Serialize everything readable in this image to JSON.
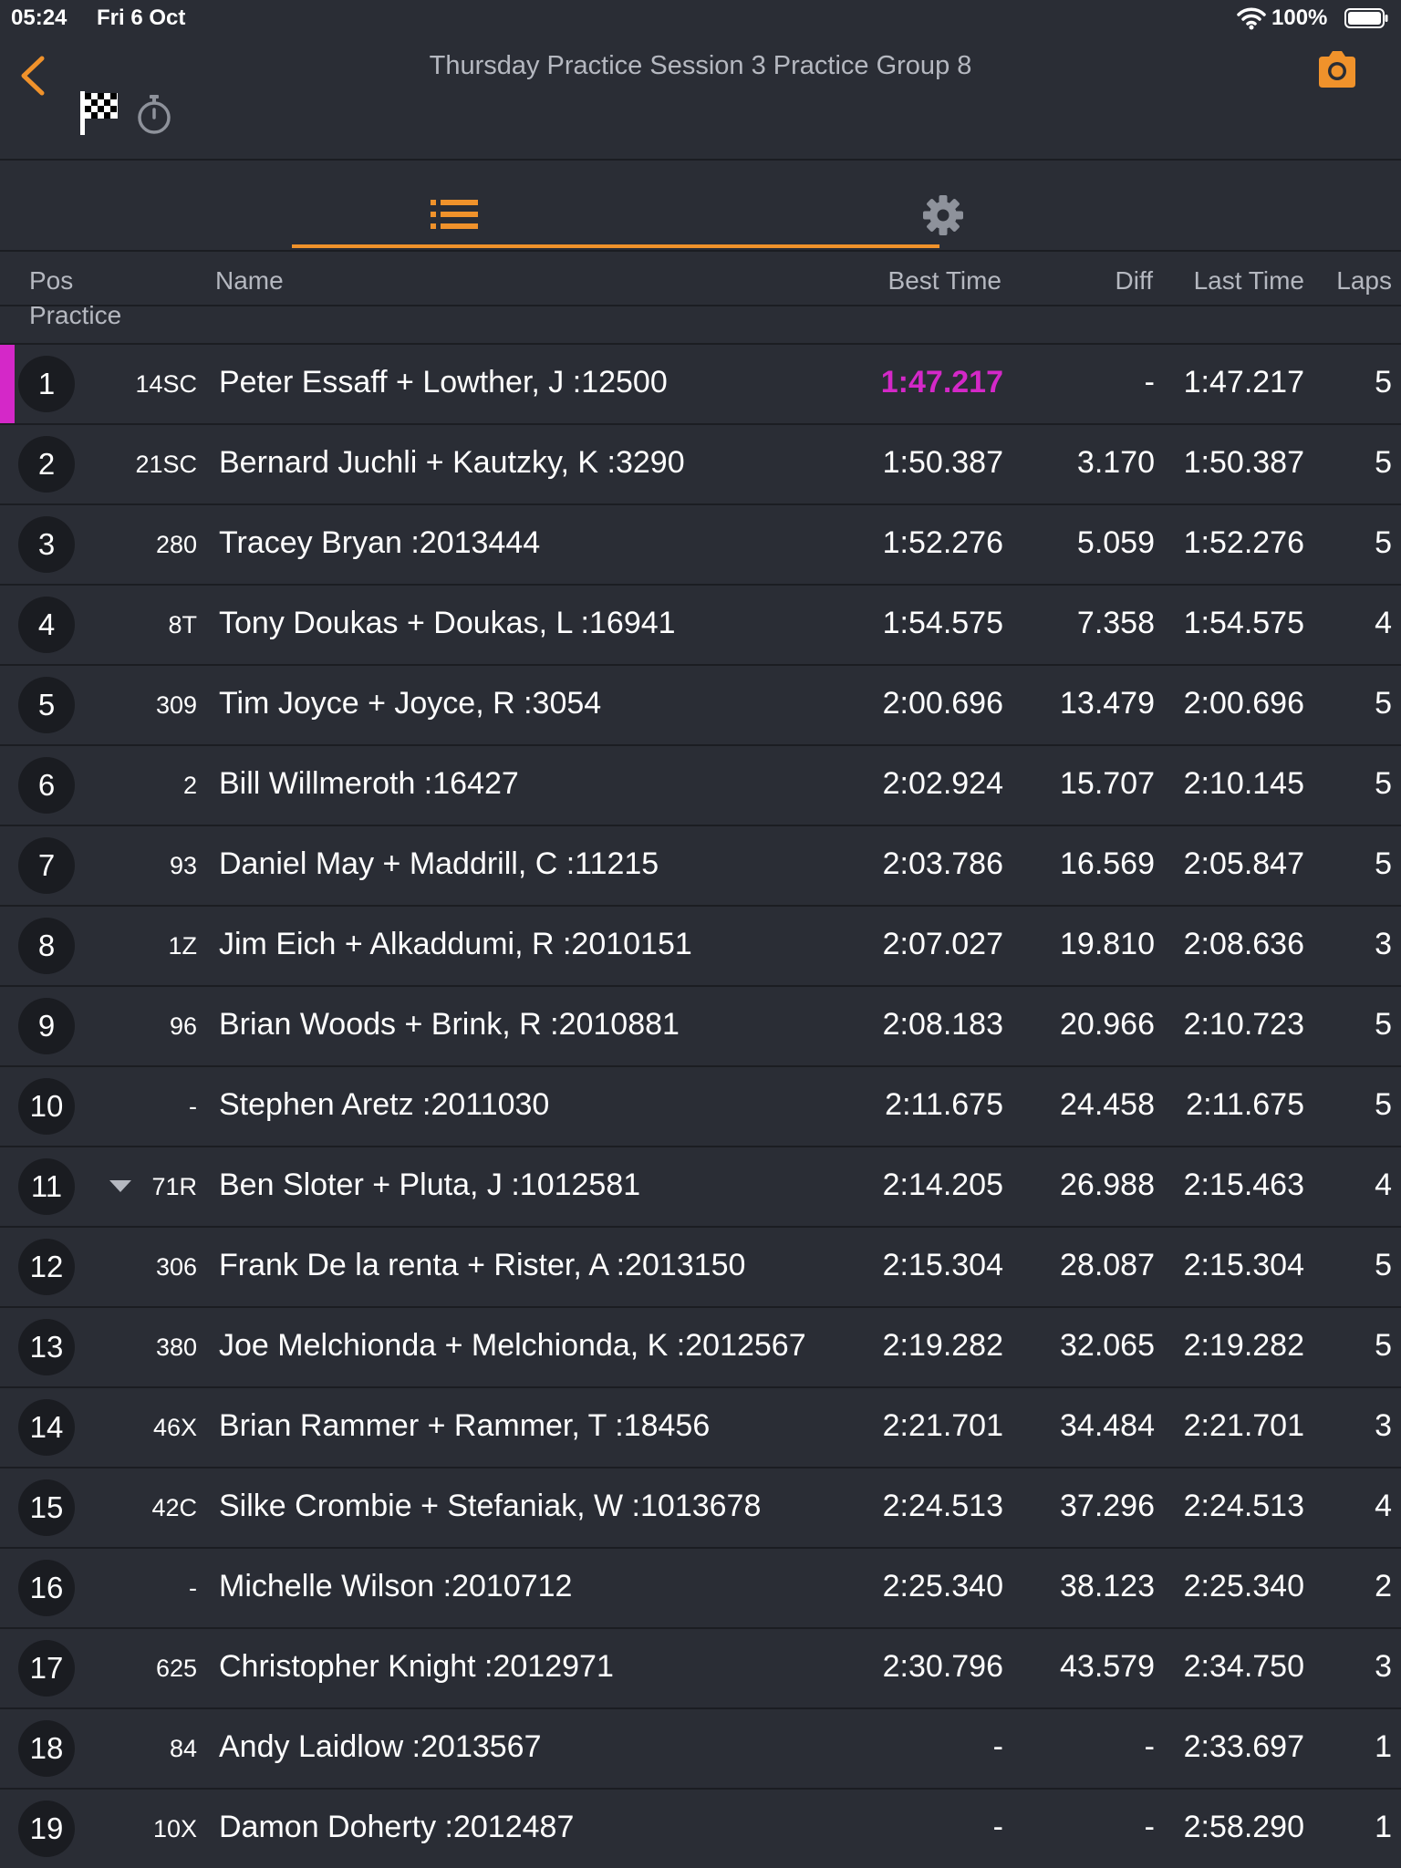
{
  "status_bar": {
    "time": "05:24",
    "date": "Fri 6 Oct",
    "battery": "100%"
  },
  "header": {
    "title": "Thursday Practice Session 3 Practice Group 8"
  },
  "icons": {
    "back": "chevron-left-icon",
    "camera": "camera-icon",
    "flag": "checkered-flag-icon",
    "stopwatch": "stopwatch-icon",
    "list_tab": "list-icon",
    "settings_tab": "gear-icon"
  },
  "colors": {
    "accent": "#f0922b",
    "fastest": "#d428c8",
    "background": "#2a2d35"
  },
  "columns": {
    "pos": "Pos",
    "name": "Name",
    "best": "Best Time",
    "diff": "Diff",
    "last": "Last Time",
    "laps": "Laps"
  },
  "group_label": "Practice",
  "rows": [
    {
      "pos": "1",
      "num": "14SC",
      "name": "Peter Essaff + Lowther, J :12500",
      "best": "1:47.217",
      "diff": "-",
      "last": "1:47.217",
      "laps": "5",
      "fastest": true
    },
    {
      "pos": "2",
      "num": "21SC",
      "name": "Bernard Juchli + Kautzky, K :3290",
      "best": "1:50.387",
      "diff": "3.170",
      "last": "1:50.387",
      "laps": "5"
    },
    {
      "pos": "3",
      "num": "280",
      "name": "Tracey Bryan :2013444",
      "best": "1:52.276",
      "diff": "5.059",
      "last": "1:52.276",
      "laps": "5"
    },
    {
      "pos": "4",
      "num": "8T",
      "name": "Tony Doukas + Doukas, L :16941",
      "best": "1:54.575",
      "diff": "7.358",
      "last": "1:54.575",
      "laps": "4"
    },
    {
      "pos": "5",
      "num": "309",
      "name": "Tim Joyce + Joyce, R :3054",
      "best": "2:00.696",
      "diff": "13.479",
      "last": "2:00.696",
      "laps": "5"
    },
    {
      "pos": "6",
      "num": "2",
      "name": "Bill Willmeroth :16427",
      "best": "2:02.924",
      "diff": "15.707",
      "last": "2:10.145",
      "laps": "5"
    },
    {
      "pos": "7",
      "num": "93",
      "name": "Daniel May + Maddrill, C :11215",
      "best": "2:03.786",
      "diff": "16.569",
      "last": "2:05.847",
      "laps": "5"
    },
    {
      "pos": "8",
      "num": "1Z",
      "name": "Jim Eich + Alkaddumi, R :2010151",
      "best": "2:07.027",
      "diff": "19.810",
      "last": "2:08.636",
      "laps": "3"
    },
    {
      "pos": "9",
      "num": "96",
      "name": "Brian Woods + Brink, R :2010881",
      "best": "2:08.183",
      "diff": "20.966",
      "last": "2:10.723",
      "laps": "5"
    },
    {
      "pos": "10",
      "num": "-",
      "name": "Stephen Aretz :2011030",
      "best": "2:11.675",
      "diff": "24.458",
      "last": "2:11.675",
      "laps": "5"
    },
    {
      "pos": "11",
      "num": "71R",
      "name": "Ben Sloter + Pluta, J :1012581",
      "best": "2:14.205",
      "diff": "26.988",
      "last": "2:15.463",
      "laps": "4",
      "arrow_down": true
    },
    {
      "pos": "12",
      "num": "306",
      "name": "Frank De la renta + Rister, A :2013150",
      "best": "2:15.304",
      "diff": "28.087",
      "last": "2:15.304",
      "laps": "5"
    },
    {
      "pos": "13",
      "num": "380",
      "name": "Joe Melchionda + Melchionda, K :2012567",
      "best": "2:19.282",
      "diff": "32.065",
      "last": "2:19.282",
      "laps": "5"
    },
    {
      "pos": "14",
      "num": "46X",
      "name": "Brian Rammer + Rammer, T :18456",
      "best": "2:21.701",
      "diff": "34.484",
      "last": "2:21.701",
      "laps": "3"
    },
    {
      "pos": "15",
      "num": "42C",
      "name": "Silke Crombie + Stefaniak, W :1013678",
      "best": "2:24.513",
      "diff": "37.296",
      "last": "2:24.513",
      "laps": "4"
    },
    {
      "pos": "16",
      "num": "-",
      "name": "Michelle Wilson :2010712",
      "best": "2:25.340",
      "diff": "38.123",
      "last": "2:25.340",
      "laps": "2"
    },
    {
      "pos": "17",
      "num": "625",
      "name": "Christopher Knight :2012971",
      "best": "2:30.796",
      "diff": "43.579",
      "last": "2:34.750",
      "laps": "3"
    },
    {
      "pos": "18",
      "num": "84",
      "name": "Andy Laidlow :2013567",
      "best": "-",
      "diff": "-",
      "last": "2:33.697",
      "laps": "1"
    },
    {
      "pos": "19",
      "num": "10X",
      "name": "Damon Doherty :2012487",
      "best": "-",
      "diff": "-",
      "last": "2:58.290",
      "laps": "1"
    }
  ]
}
